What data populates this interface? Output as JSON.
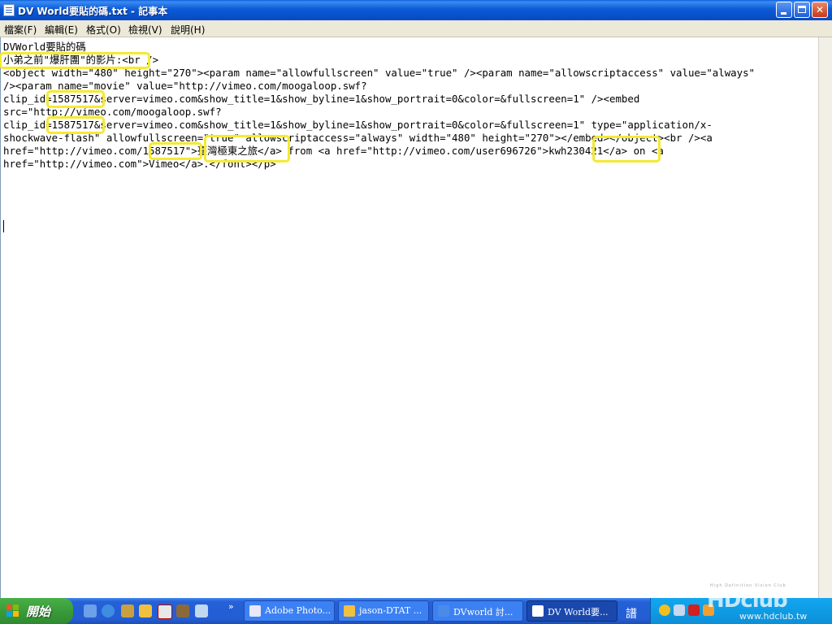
{
  "window": {
    "title": "DV World要貼的碼.txt - 記事本",
    "controls": {
      "minimize": "",
      "maximize": "",
      "close": "✕"
    }
  },
  "menu": {
    "items": [
      "檔案(F)",
      "編輯(E)",
      "格式(O)",
      "檢視(V)",
      "說明(H)"
    ]
  },
  "document": {
    "lines": [
      "DVWorld要貼的碼",
      "小弟之前\"爆肝團\"的影片:<br />",
      "<object width=\"480\" height=\"270\"><param name=\"allowfullscreen\" value=\"true\" /><param name=\"allowscriptaccess\" value=\"always\"",
      "/><param name=\"movie\" value=\"http://vimeo.com/moogaloop.swf?",
      "clip_id=1587517&server=vimeo.com&show_title=1&show_byline=1&show_portrait=0&color=&fullscreen=1\" /><embed",
      "src=\"http://vimeo.com/moogaloop.swf?",
      "clip_id=1587517&server=vimeo.com&show_title=1&show_byline=1&show_portrait=0&color=&fullscreen=1\" type=\"application/x-",
      "shockwave-flash\" allowfullscreen=\"true\" allowscriptaccess=\"always\" width=\"480\" height=\"270\"></embed></object><br /><a",
      "href=\"http://vimeo.com/1587517\">臺灣極東之旅</a> from <a href=\"http://vimeo.com/user696726\">kwh230421</a> on <a",
      "href=\"http://vimeo.com\">Vimeo</a>.</font></p>"
    ]
  },
  "taskbar": {
    "start_label": "開始",
    "quick_launch_more": "»",
    "tasks": [
      {
        "label": "Adobe Photo...",
        "active": false,
        "icon_color": "#e8e8f8"
      },
      {
        "label": "jason-DTAT ...",
        "active": false,
        "icon_color": "#f0c040"
      },
      {
        "label": "DVworld 討...",
        "active": false,
        "icon_color": "#4a8be8"
      },
      {
        "label": "DV World要...",
        "active": true,
        "icon_color": "#ffffff"
      }
    ],
    "language_indicator": "譜"
  },
  "watermark": {
    "tagline": "High Definition Vision Club",
    "logo": "HDclub",
    "url": "www.hdclub.tw"
  }
}
